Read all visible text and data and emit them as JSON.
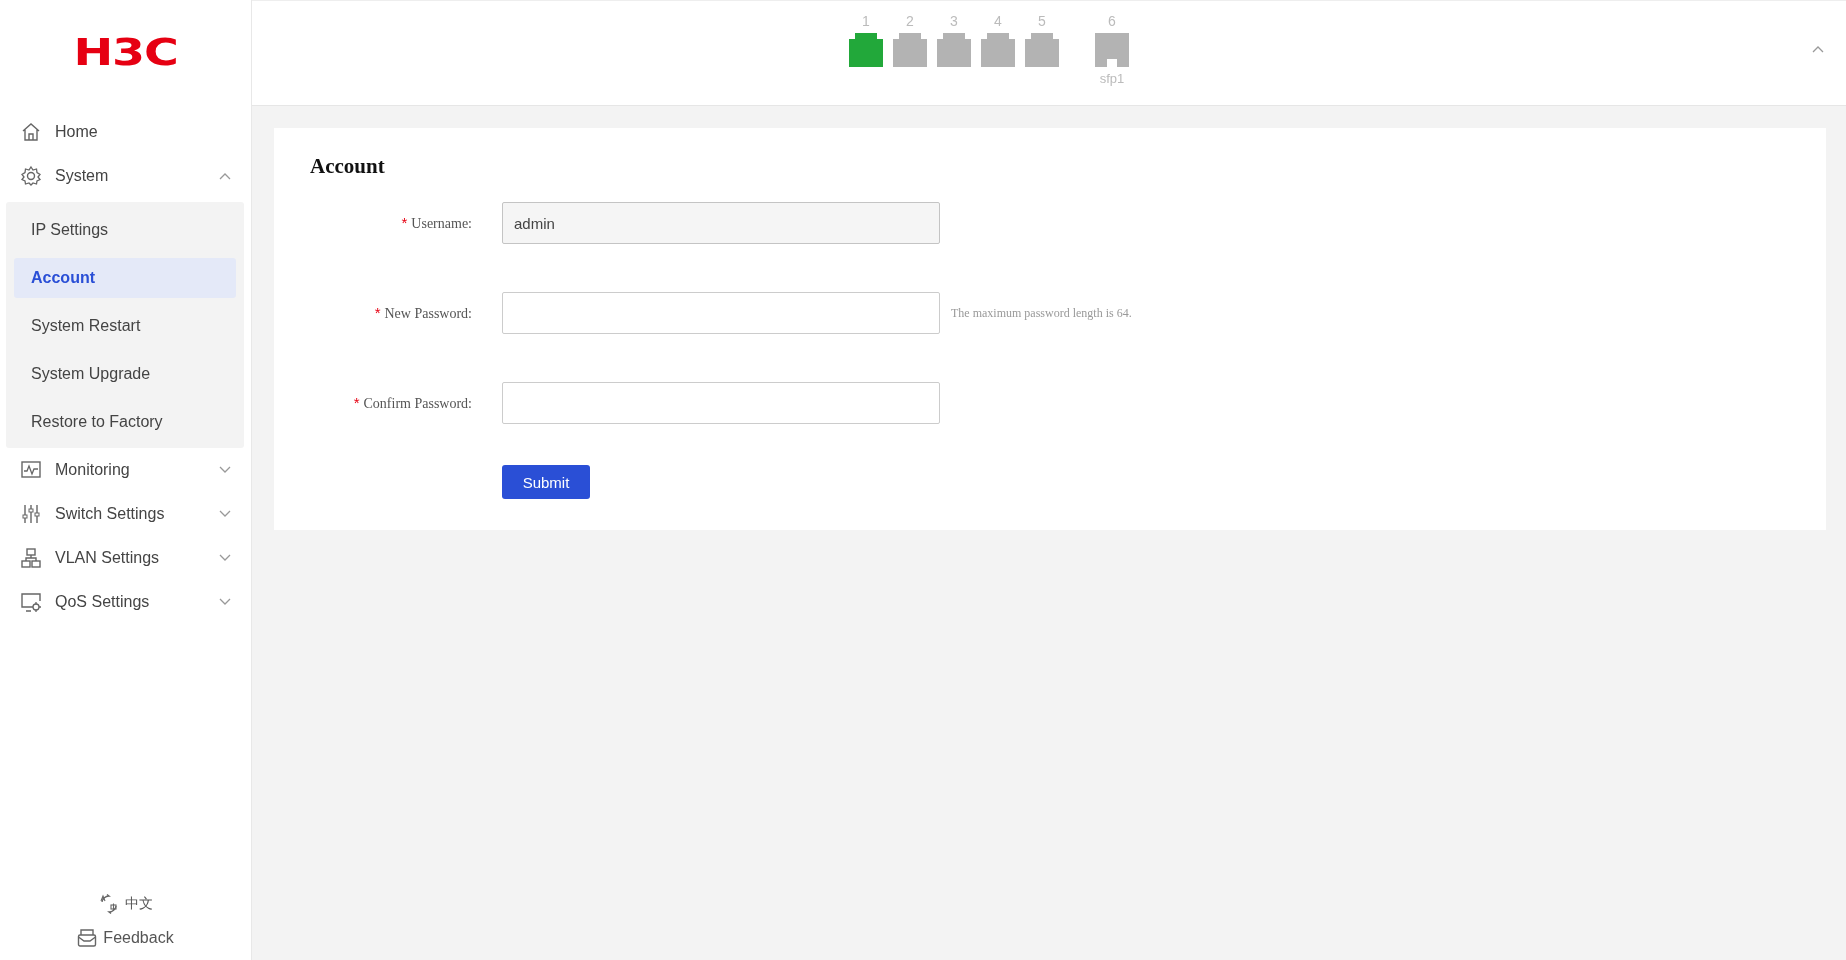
{
  "logo": "H3C",
  "sidebar": {
    "items": [
      {
        "label": "Home"
      },
      {
        "label": "System",
        "expanded": true,
        "children": [
          {
            "label": "IP Settings",
            "selected": false
          },
          {
            "label": "Account",
            "selected": true
          },
          {
            "label": "System Restart",
            "selected": false
          },
          {
            "label": "System Upgrade",
            "selected": false
          },
          {
            "label": "Restore to Factory",
            "selected": false
          }
        ]
      },
      {
        "label": "Monitoring",
        "expanded": false
      },
      {
        "label": "Switch Settings",
        "expanded": false
      },
      {
        "label": "VLAN Settings",
        "expanded": false
      },
      {
        "label": "QoS Settings",
        "expanded": false
      }
    ],
    "language": "中文",
    "feedback": "Feedback"
  },
  "ports": [
    {
      "number": "1",
      "kind": "rj45",
      "linked": true
    },
    {
      "number": "2",
      "kind": "rj45",
      "linked": false
    },
    {
      "number": "3",
      "kind": "rj45",
      "linked": false
    },
    {
      "number": "4",
      "kind": "rj45",
      "linked": false
    },
    {
      "number": "5",
      "kind": "rj45",
      "linked": false
    },
    {
      "number": "6",
      "kind": "sfp",
      "linked": false,
      "sublabel": "sfp1"
    }
  ],
  "header": {
    "expanded": true
  },
  "form": {
    "title": "Account",
    "fields": [
      {
        "mark": "*",
        "label": "Username:",
        "value": "admin",
        "disabled": true
      },
      {
        "mark": "*",
        "label": "New Password:",
        "hint": "The maximum password length is 64."
      },
      {
        "mark": "*",
        "label": "Confirm Password:"
      }
    ],
    "submit": "Submit"
  }
}
